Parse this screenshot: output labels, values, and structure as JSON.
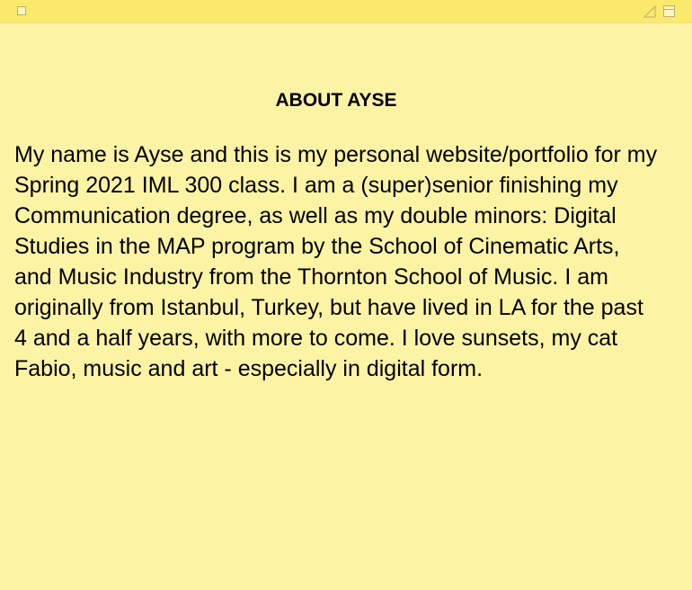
{
  "window": {
    "background_color": "#fdf3a5",
    "titlebar_color": "#fbe96e",
    "controls": {
      "close_icon": "square-box-icon",
      "zoom_icon": "corner-triangle-icon",
      "collapse_icon": "window-collapse-icon"
    }
  },
  "note": {
    "heading": "ABOUT AYSE",
    "body": "My name is Ayse and this is my personal website/portfolio for my Spring 2021 IML 300 class. I am a (super)senior finishing my Communication degree, as well as my double minors: Digital Studies in the MAP program by the School of Cinematic Arts, and Music Industry from the Thornton School of Music. I am originally from Istanbul, Turkey, but have lived in LA for the past 4 and a half years, with more to come. I love sunsets, my cat Fabio, music and art - especially in digital form."
  }
}
